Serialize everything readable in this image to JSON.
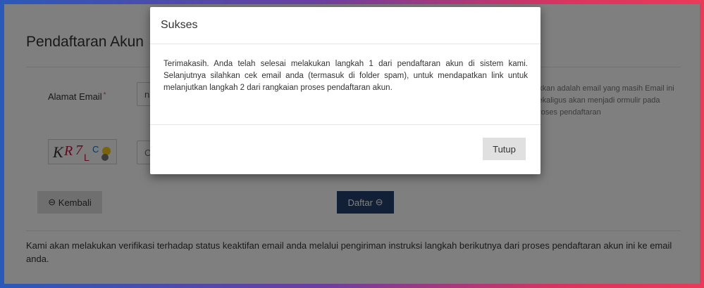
{
  "page": {
    "title": "Pendaftaran Akun",
    "email_label": "Alamat Email",
    "required_mark": "*",
    "email_value": "n",
    "email_help": "ukkan adalah email yang masih Email ini sekaligus akan menjadi ormulir pada proses pendaftaran",
    "captcha_placeholder": "C",
    "captcha_text": "KR7LC",
    "back_label": "Kembali",
    "back_icon": "⊖",
    "register_label": "Daftar",
    "register_icon": "⊖",
    "footer_note": "Kami akan melakukan verifikasi terhadap status keaktifan email anda melalui pengiriman instruksi langkah berikutnya dari proses pendaftaran akun ini ke email anda."
  },
  "modal": {
    "title": "Sukses",
    "body": "Terimakasih. Anda telah selesai melakukan langkah 1 dari pendaftaran akun di sistem kami. Selanjutnya silahkan cek email anda (termasuk di folder spam), untuk mendapatkan link untuk melanjutkan langkah 2 dari rangkaian proses pendaftaran akun.",
    "close_label": "Tutup"
  },
  "colors": {
    "primary_button": "#24406e",
    "border_gradient_left": "#2b59b8",
    "border_gradient_right": "#ea3a5a"
  }
}
